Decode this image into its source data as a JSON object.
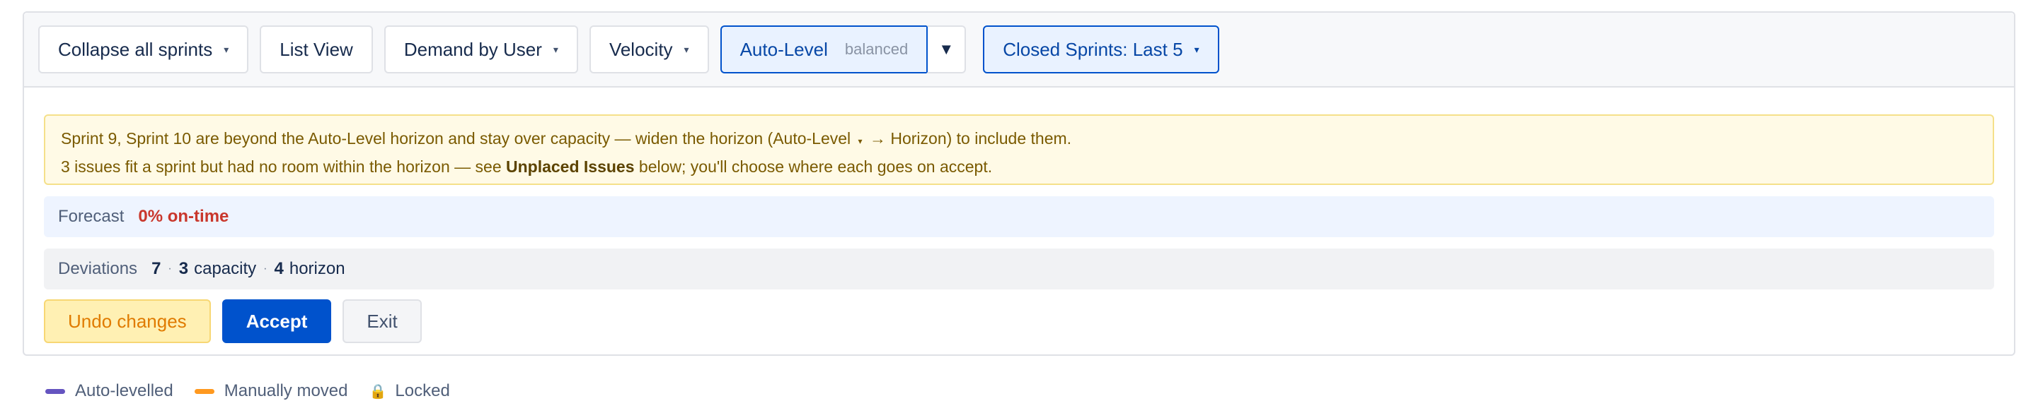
{
  "toolbar": {
    "collapse_label": "Collapse all sprints",
    "list_view_label": "List View",
    "demand_label": "Demand by User",
    "velocity_label": "Velocity",
    "autolevel_label": "Auto-Level",
    "autolevel_mode": "balanced",
    "closed_sprints_label": "Closed Sprints: Last 5",
    "caret_icon": "▾",
    "dropdown_icon": "▼"
  },
  "warning": {
    "line1_a": "Sprint 9, Sprint 10 are beyond the Auto-Level horizon and stay over capacity — widen the horizon (Auto-Level",
    "line1_b": "→ Horizon) to include them.",
    "line2_a": "3 issues fit a sprint but had no room within the horizon — see",
    "line2_bold": "Unplaced Issues",
    "line2_b": "below; you'll choose where each goes on accept."
  },
  "forecast": {
    "label": "Forecast",
    "value": "0% on-time"
  },
  "deviations": {
    "label": "Deviations",
    "total": "7",
    "capacity_count": "3",
    "capacity_label": "capacity",
    "horizon_count": "4",
    "horizon_label": "horizon",
    "separator": "·"
  },
  "actions": {
    "undo_label": "Undo changes",
    "accept_label": "Accept",
    "exit_label": "Exit"
  },
  "legend": {
    "auto_label": "Auto-levelled",
    "manual_label": "Manually moved",
    "locked_label": "Locked",
    "auto_color": "#6554c0",
    "manual_color": "#ff991f",
    "lock_glyph": "🔒"
  }
}
